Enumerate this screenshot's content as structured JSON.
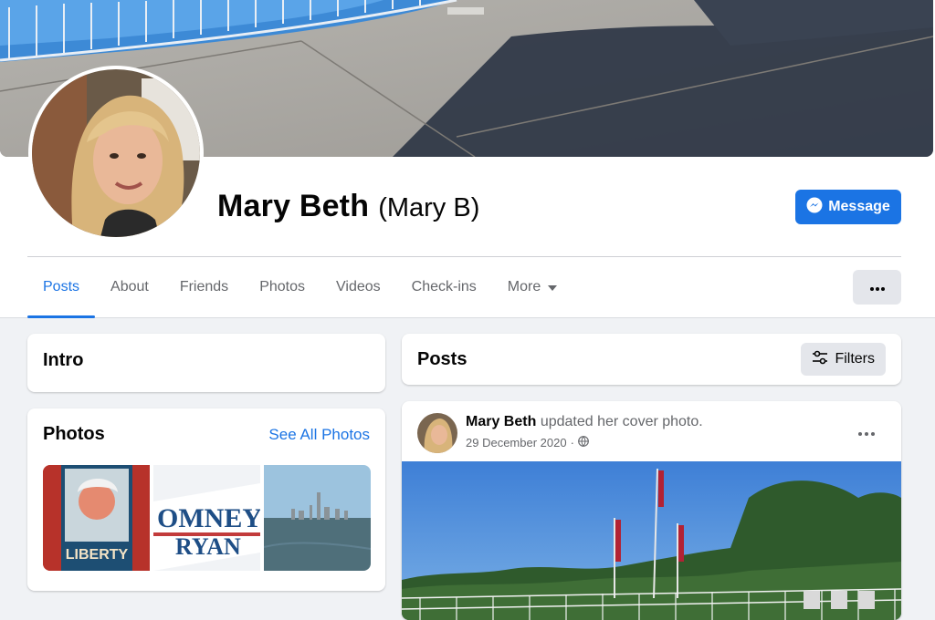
{
  "profile": {
    "name": "Mary Beth",
    "alternate_name": "(Mary B)",
    "message_button": "Message"
  },
  "tabs": [
    {
      "label": "Posts",
      "active": true
    },
    {
      "label": "About"
    },
    {
      "label": "Friends"
    },
    {
      "label": "Photos"
    },
    {
      "label": "Videos"
    },
    {
      "label": "Check-ins"
    },
    {
      "label": "More"
    }
  ],
  "intro": {
    "title": "Intro"
  },
  "photos": {
    "title": "Photos",
    "see_all": "See All Photos"
  },
  "posts_section": {
    "title": "Posts",
    "filters_label": "Filters"
  },
  "post": {
    "author": "Mary Beth",
    "action": "updated her cover photo.",
    "date": "29 December 2020",
    "separator": "·"
  },
  "colors": {
    "accent": "#1b74e4",
    "background": "#f0f2f5",
    "secondary_text": "#65676b"
  }
}
